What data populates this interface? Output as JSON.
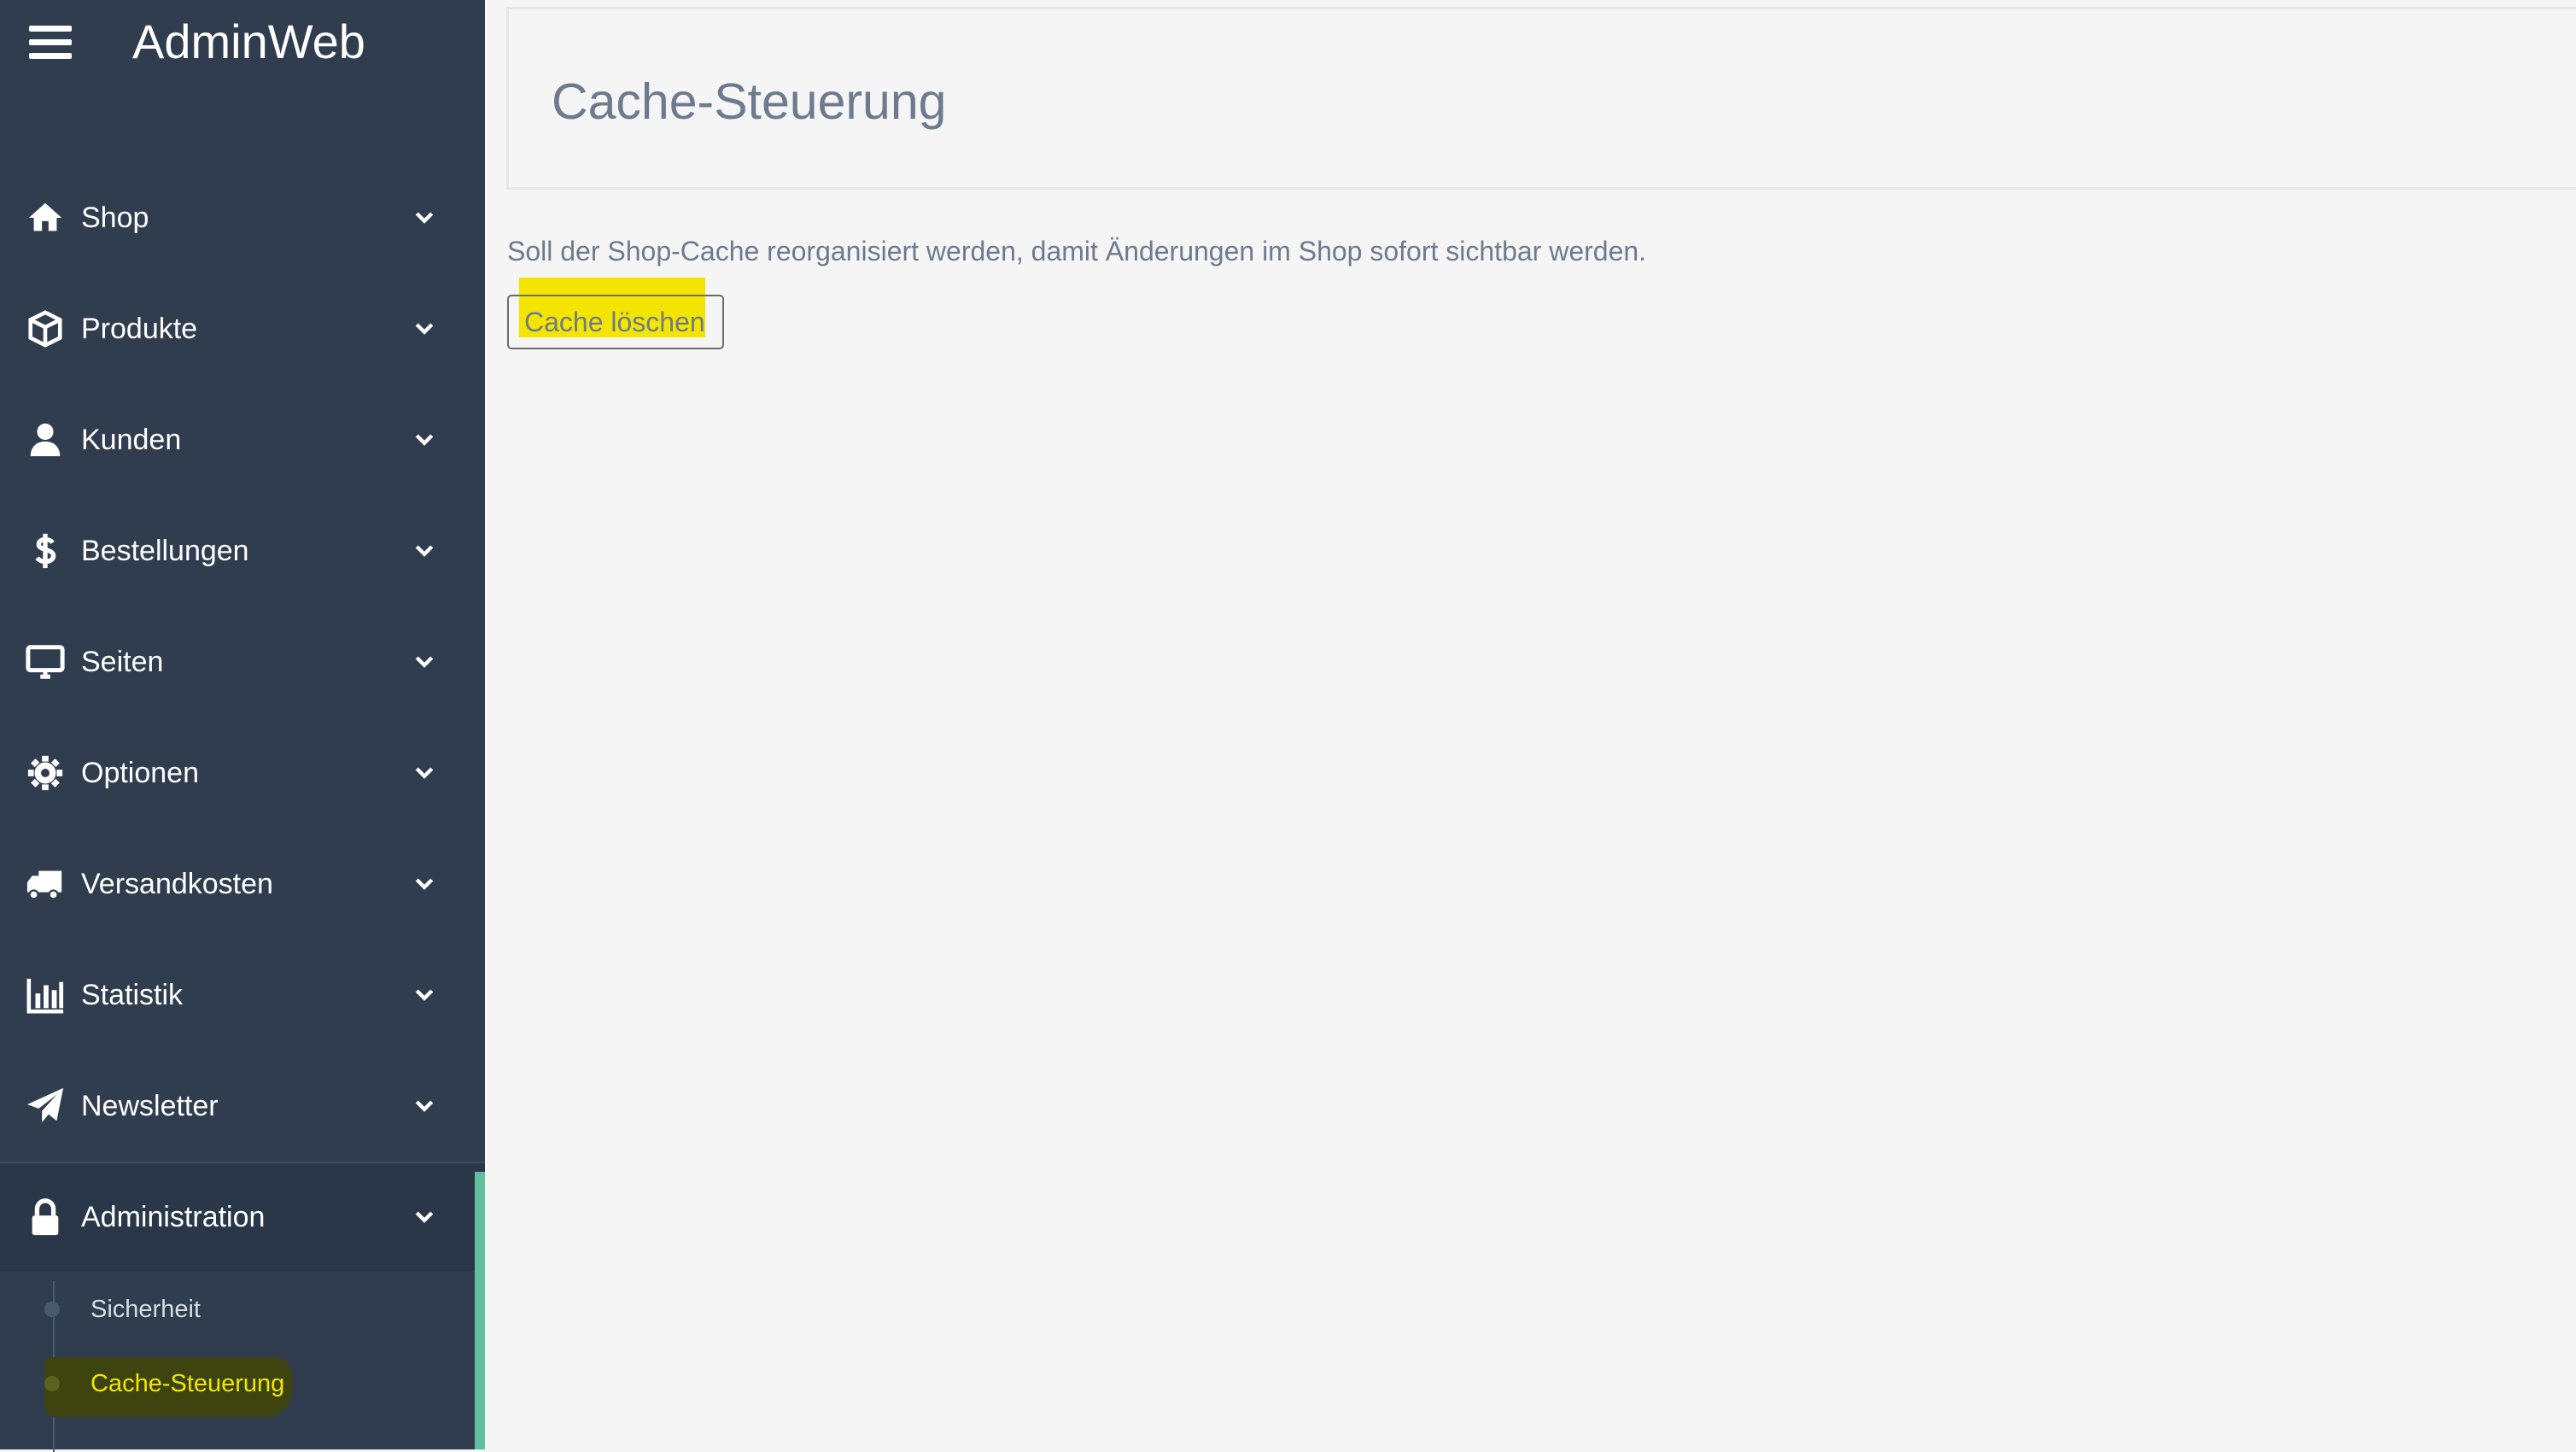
{
  "app": {
    "brand": "AdminWeb"
  },
  "sidebar": {
    "items": [
      {
        "label": "Shop",
        "icon": "home-icon"
      },
      {
        "label": "Produkte",
        "icon": "box-icon"
      },
      {
        "label": "Kunden",
        "icon": "user-icon"
      },
      {
        "label": "Bestellungen",
        "icon": "dollar-icon"
      },
      {
        "label": "Seiten",
        "icon": "monitor-icon"
      },
      {
        "label": "Optionen",
        "icon": "gear-icon"
      },
      {
        "label": "Versandkosten",
        "icon": "truck-icon"
      },
      {
        "label": "Statistik",
        "icon": "bar-chart-icon"
      },
      {
        "label": "Newsletter",
        "icon": "paper-plane-icon"
      },
      {
        "label": "Administration",
        "icon": "lock-icon",
        "expanded": true
      }
    ],
    "subitems": [
      {
        "label": "Sicherheit"
      },
      {
        "label": "Cache-Steuerung",
        "current": true
      }
    ],
    "accent_color": "#5fbf9e"
  },
  "main": {
    "title": "Cache-Steuerung",
    "description": "Soll der Shop-Cache reorganisiert werden, damit Änderungen im Shop sofort sichtbar werden.",
    "button_label": "Cache löschen",
    "highlight_color": "#f3e500"
  }
}
